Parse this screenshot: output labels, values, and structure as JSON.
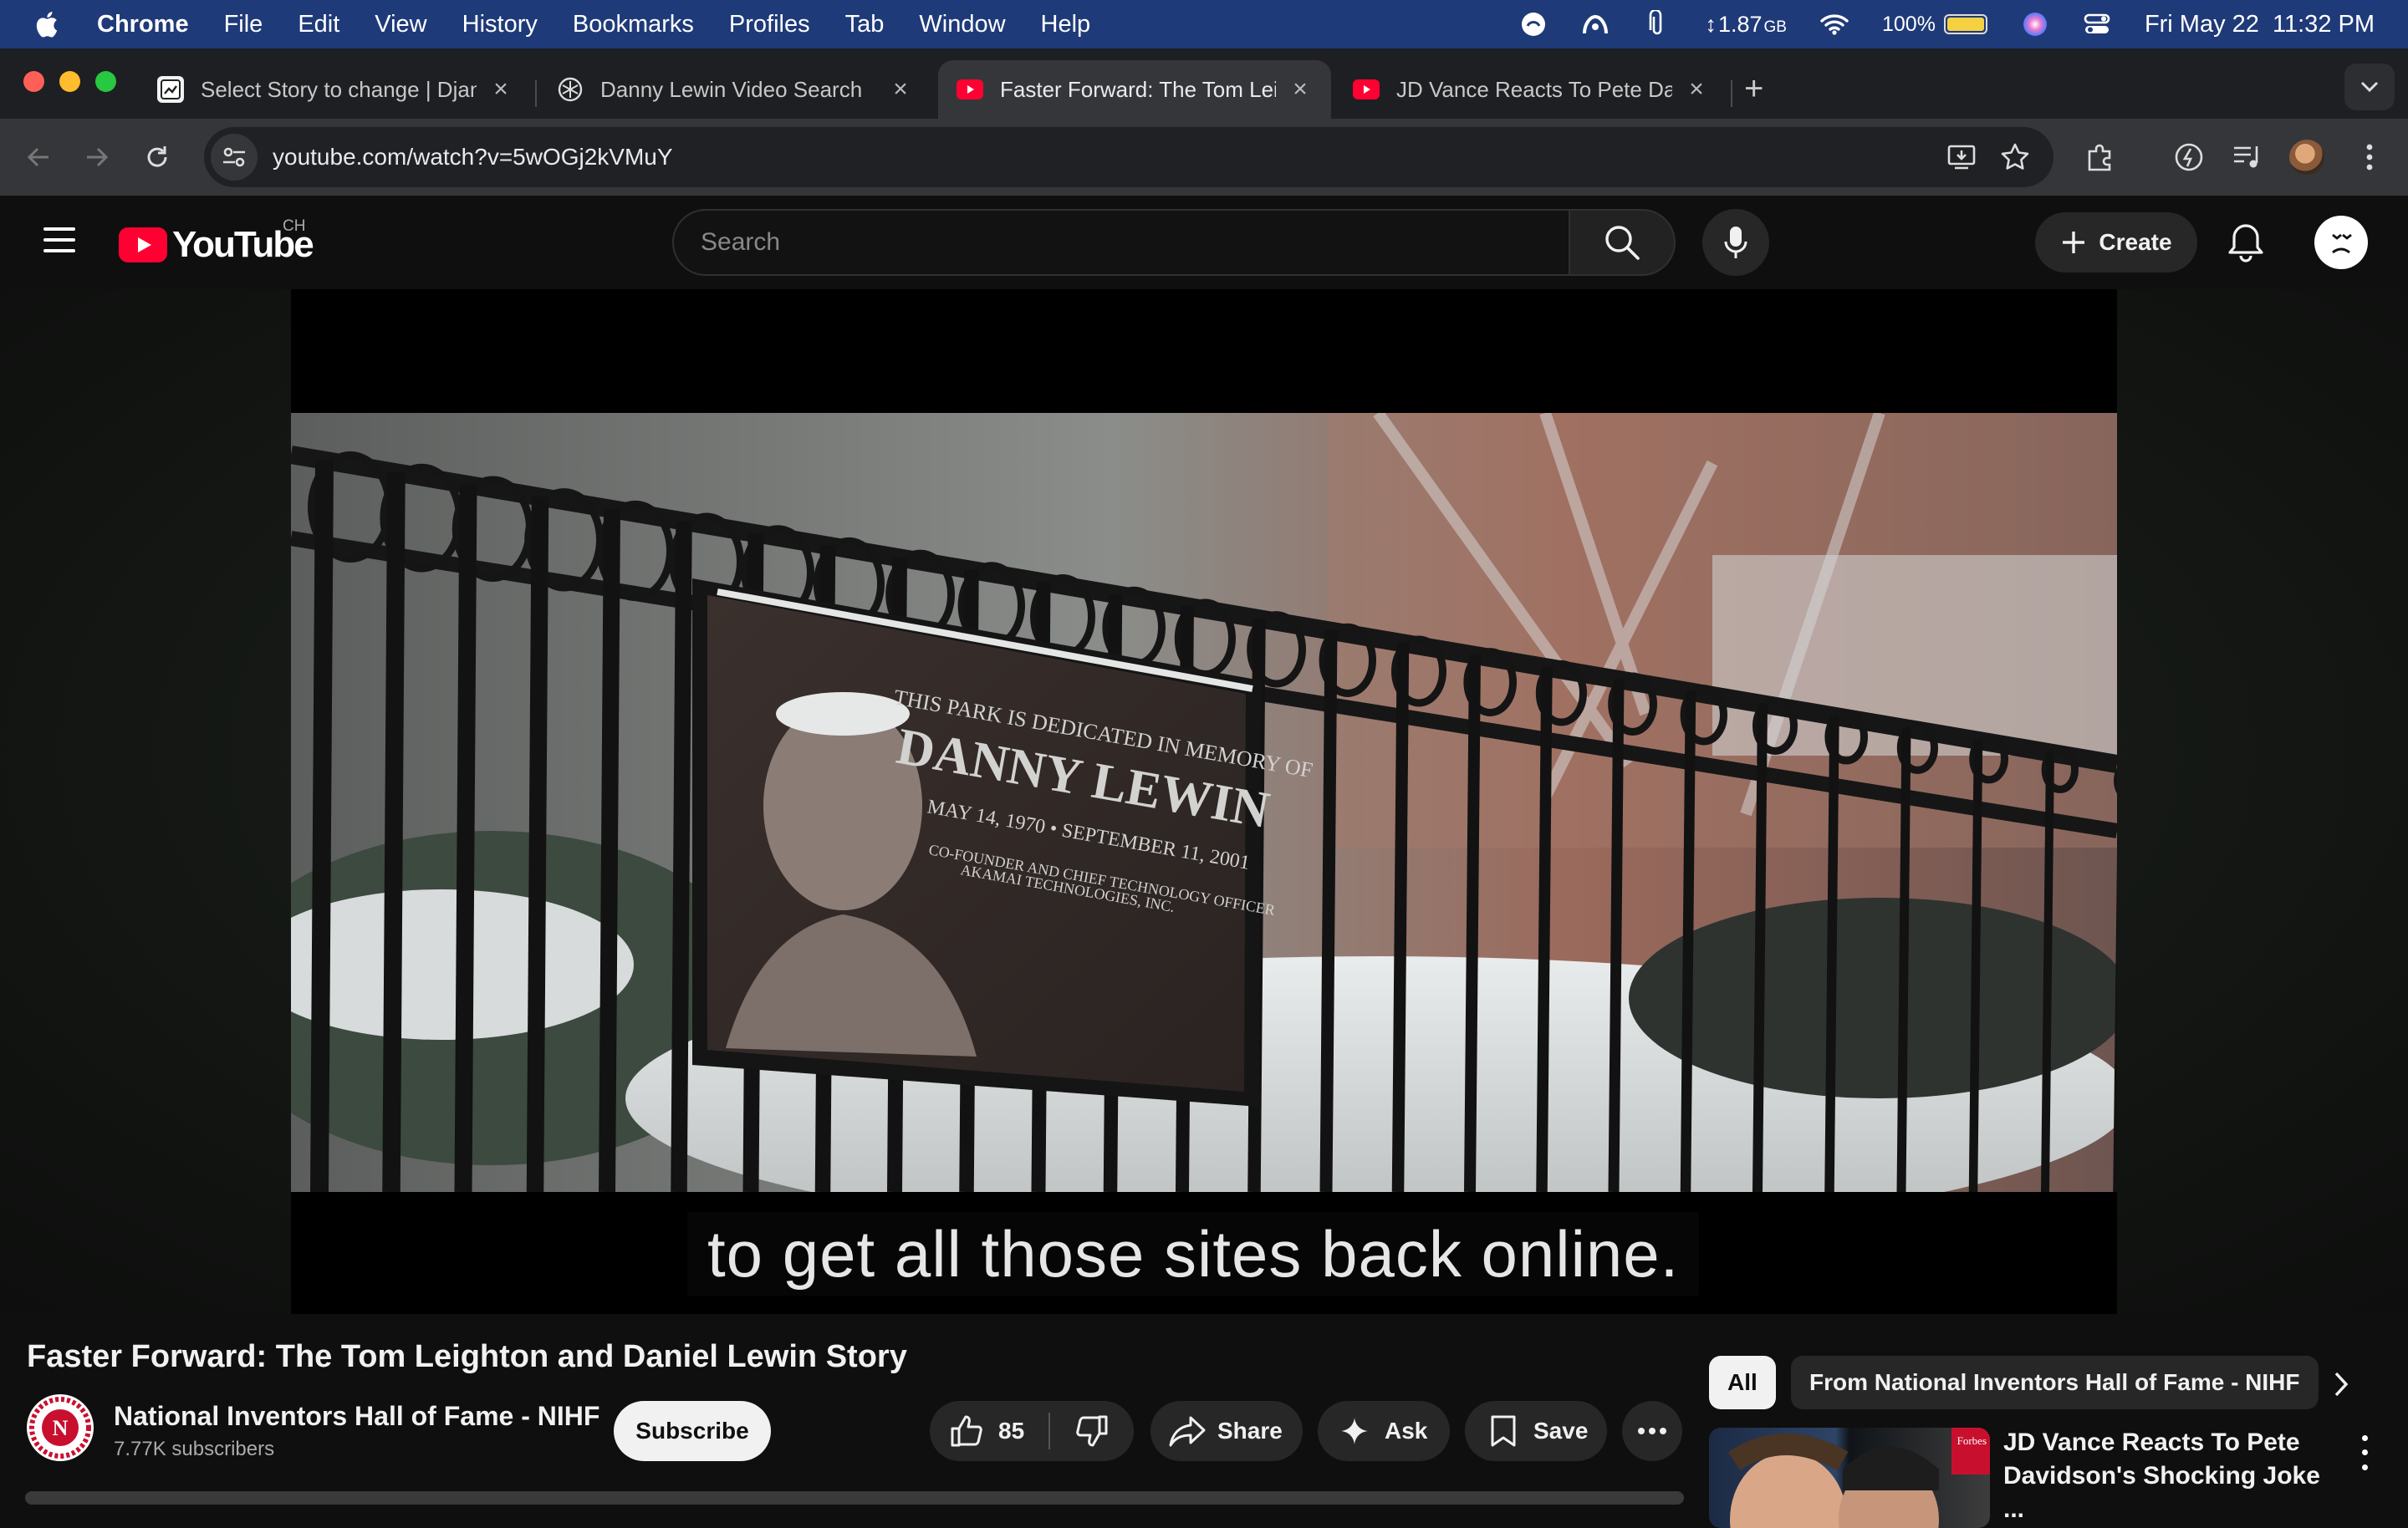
{
  "menubar": {
    "app_name": "Chrome",
    "items": [
      "File",
      "Edit",
      "View",
      "History",
      "Bookmarks",
      "Profiles",
      "Tab",
      "Window",
      "Help"
    ],
    "memory": "1.87",
    "memory_unit": "GB",
    "battery": "100%",
    "battery_level": 1.0,
    "datetime": "Fri May 22  11:32 PM"
  },
  "tabs": [
    {
      "title": "Select Story to change | Djang",
      "icon": "django-admin-icon"
    },
    {
      "title": "Danny Lewin Video Search",
      "icon": "openai-icon"
    },
    {
      "title": "Faster Forward: The Tom Leig",
      "icon": "youtube-icon"
    },
    {
      "title": "JD Vance Reacts To Pete Dav",
      "icon": "youtube-icon"
    }
  ],
  "active_tab": 2,
  "omnibox": {
    "url": "youtube.com/watch?v=5wOGj2kVMuY"
  },
  "youtube": {
    "brand": "YouTube",
    "country_code": "CH",
    "search_placeholder": "Search",
    "create_label": "Create"
  },
  "video": {
    "plaque_line1": "THIS PARK IS DEDICATED IN MEMORY OF",
    "plaque_name": "DANNY LEWIN",
    "plaque_dates": "MAY 14, 1970 • SEPTEMBER 11, 2001",
    "plaque_role": "CO-FOUNDER AND CHIEF TECHNOLOGY OFFICER",
    "plaque_company": "AKAMAI TECHNOLOGIES, INC.",
    "caption": "to get all those sites back online."
  },
  "details": {
    "title": "Faster Forward: The Tom Leighton and Daniel Lewin Story",
    "channel_name": "National Inventors Hall of Fame - NIHF",
    "subscribers": "7.77K subscribers",
    "subscribe_label": "Subscribe",
    "like_count": "85",
    "share_label": "Share",
    "ask_label": "Ask",
    "save_label": "Save"
  },
  "sidebar": {
    "chips": [
      "All",
      "From National Inventors Hall of Fame - NIHF"
    ],
    "recommendation": {
      "title": "JD Vance Reacts To Pete Davidson's Shocking Joke ...",
      "badge": "Forbes"
    }
  },
  "colors": {
    "menubar": "#1f3a78",
    "youtube_red": "#ff0033",
    "page_bg": "#0f0f0f"
  }
}
